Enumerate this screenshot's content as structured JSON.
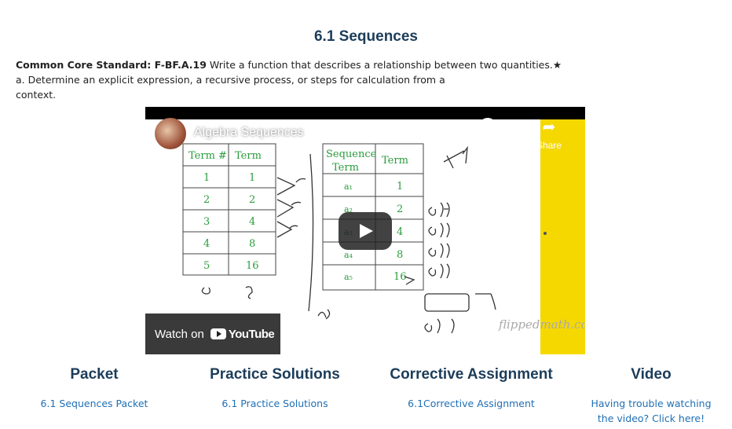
{
  "page": {
    "title": "6.1 Sequences",
    "standard_label": "Common Core Standard: F-BF.A.19",
    "standard_text": " Write a function that describes a relationship between two quantities.★",
    "standard_line2": "a. Determine an explicit expression, a recursive process, or steps for calculation from a",
    "standard_line3": "context."
  },
  "video": {
    "title": "Algebra Sequences",
    "watch_later": "Watch later",
    "share": "Share",
    "watch_on": "Watch on",
    "youtube": "YouTube",
    "watermark": "flippedmath.com",
    "table1": {
      "headers": [
        "Term #",
        "Term"
      ],
      "rows": [
        [
          "1",
          "1"
        ],
        [
          "2",
          "2"
        ],
        [
          "3",
          "4"
        ],
        [
          "4",
          "8"
        ],
        [
          "5",
          "16"
        ]
      ]
    },
    "table2": {
      "headers": [
        "Sequence Term",
        "Term"
      ],
      "rows": [
        [
          "a₁",
          "1"
        ],
        [
          "a₂",
          "2"
        ],
        [
          "a₃",
          "4"
        ],
        [
          "a₄",
          "8"
        ],
        [
          "a₅",
          "16"
        ]
      ]
    }
  },
  "sections": [
    {
      "heading": "Packet",
      "link": "6.1 Sequences Packet"
    },
    {
      "heading": "Practice Solutions",
      "link": "6.1 Practice Solutions"
    },
    {
      "heading": "Corrective Assignment",
      "link": "6.1Corrective Assignment"
    },
    {
      "heading": "Video",
      "link": "Having trouble watching the video?  Click here!"
    }
  ]
}
